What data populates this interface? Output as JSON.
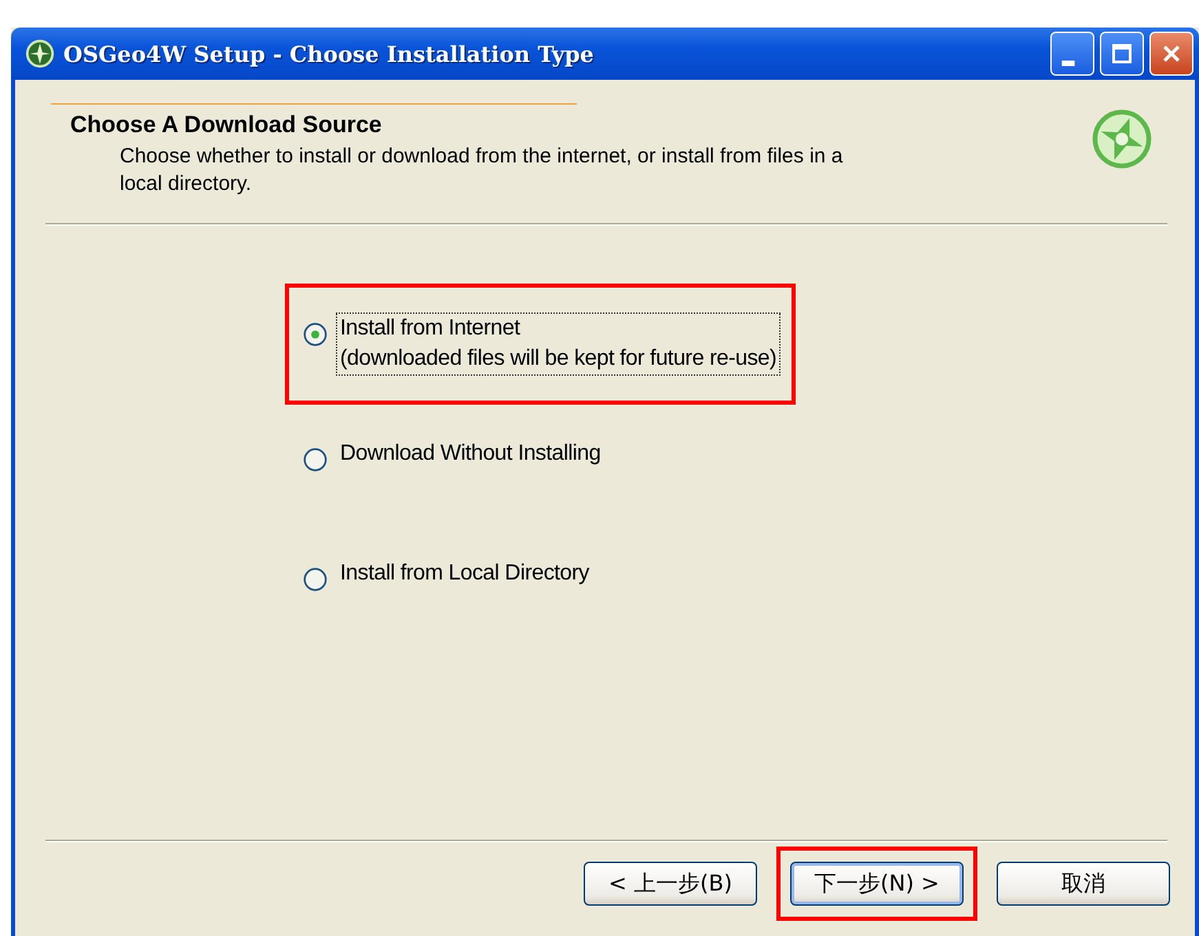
{
  "window": {
    "title": "OSGeo4W Setup - Choose Installation Type"
  },
  "header": {
    "title": "Choose A Download Source",
    "description": "Choose whether to install or download from the internet, or install from files in a local directory."
  },
  "options": [
    {
      "label": "Install from Internet\n(downloaded files will be kept for future re-use)",
      "selected": true,
      "highlighted": true
    },
    {
      "label": "Download Without Installing",
      "selected": false,
      "highlighted": false
    },
    {
      "label": "Install from Local Directory",
      "selected": false,
      "highlighted": false
    }
  ],
  "buttons": [
    {
      "label": "< 上一步(B)",
      "default": false,
      "highlighted": false
    },
    {
      "label": "下一步(N) >",
      "default": true,
      "highlighted": true
    },
    {
      "label": "取消",
      "default": false,
      "highlighted": false
    }
  ]
}
